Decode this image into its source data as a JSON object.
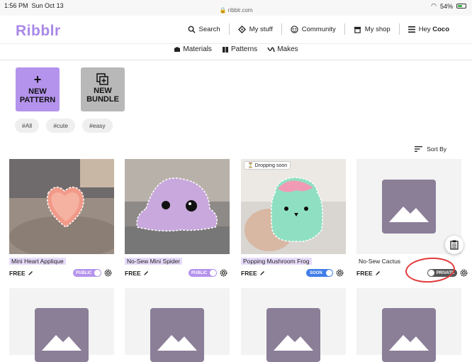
{
  "status": {
    "time": "1:56 PM",
    "date": "Sun Oct 13",
    "url": "ribblr.com",
    "battery": "54%"
  },
  "header": {
    "logo": "Ribblr",
    "nav": [
      {
        "label": "Search",
        "icon": "search-icon"
      },
      {
        "label": "My stuff",
        "icon": "diamond-icon"
      },
      {
        "label": "Community",
        "icon": "community-icon"
      },
      {
        "label": "My shop",
        "icon": "shop-icon"
      }
    ],
    "greeting_prefix": "Hey",
    "greeting_name": "Coco"
  },
  "subnav": [
    {
      "label": "Materials",
      "icon": "yarn-icon"
    },
    {
      "label": "Patterns",
      "icon": "book-icon"
    },
    {
      "label": "Makes",
      "icon": "scissors-icon"
    }
  ],
  "actions": {
    "new_pattern": [
      "NEW",
      "PATTERN"
    ],
    "new_bundle": [
      "NEW",
      "BUNDLE"
    ]
  },
  "tags": [
    "#All",
    "#cute",
    "#easy"
  ],
  "sort_label": "Sort By",
  "cards": [
    {
      "title": "Mini Heart Applique",
      "price": "FREE",
      "status": "PUBLIC",
      "image": "pink-heart-photo"
    },
    {
      "title": "No-Sew Mini Spider",
      "price": "FREE",
      "status": "PUBLIC",
      "image": "purple-spider-photo"
    },
    {
      "title": "Popping Mushroom Frog",
      "price": "FREE",
      "status": "SOON",
      "badge": "Dropping soon",
      "image": "frog-photo"
    },
    {
      "title": "No-Sew Cactus",
      "price": "FREE",
      "status": "PRIVATE",
      "image": "placeholder-image"
    }
  ],
  "colors": {
    "brand": "#a988e8",
    "public": "#b493ec",
    "soon": "#3f7de8",
    "private": "#555555",
    "annotation": "#e23b3b"
  }
}
